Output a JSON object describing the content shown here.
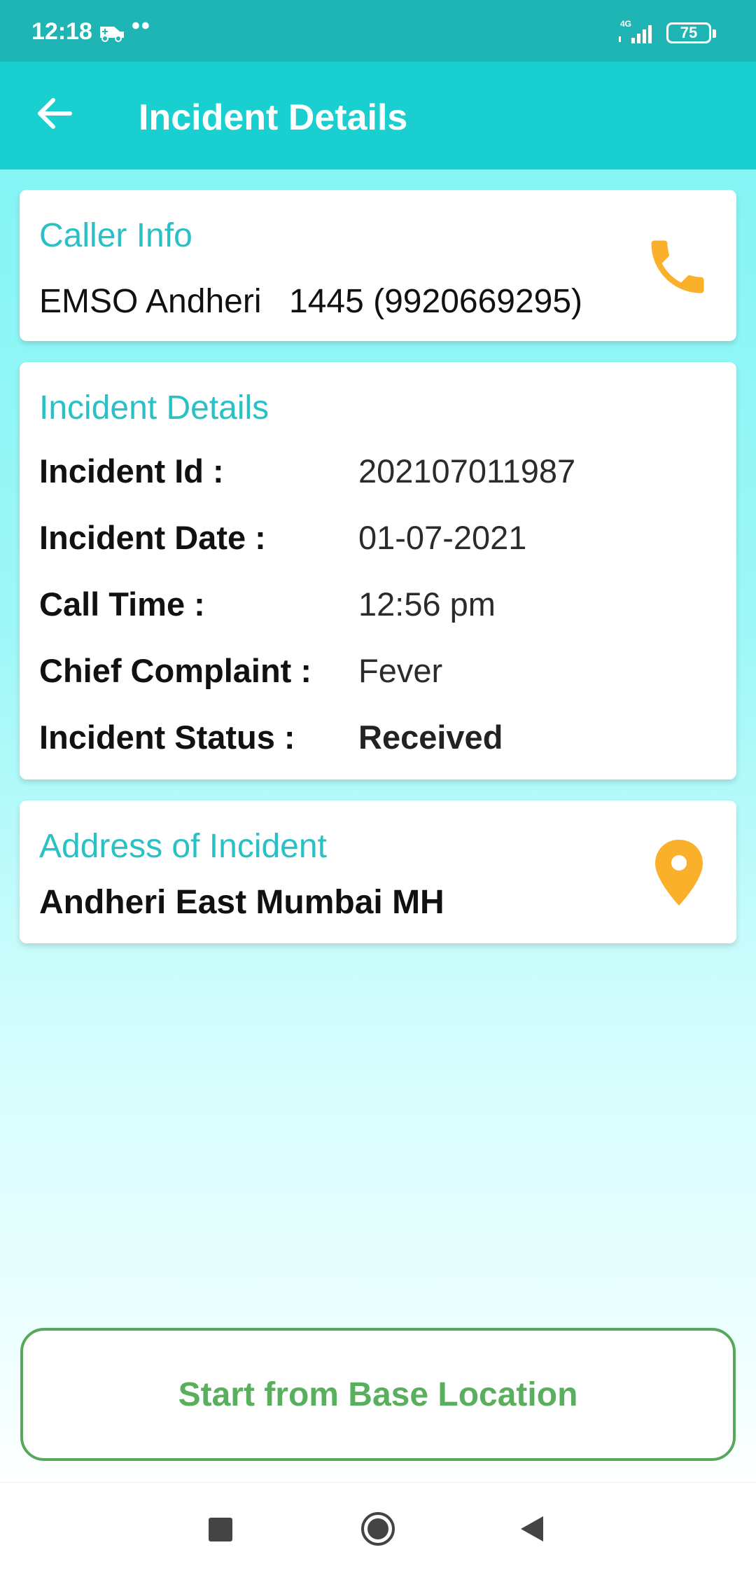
{
  "status_bar": {
    "time": "12:18",
    "dots": "••",
    "network": "4G",
    "battery": "75"
  },
  "app_bar": {
    "title": "Incident Details",
    "back_icon": "arrow-left-icon"
  },
  "caller_info": {
    "title": "Caller Info",
    "name": "EMSO Andheri",
    "number": "1445 (9920669295)",
    "action_icon": "phone-icon"
  },
  "incident_details": {
    "title": "Incident Details",
    "rows": [
      {
        "label": "Incident Id :",
        "value": "202107011987"
      },
      {
        "label": "Incident Date :",
        "value": "01-07-2021"
      },
      {
        "label": "Call Time :",
        "value": "12:56 pm"
      },
      {
        "label": "Chief Complaint :",
        "value": "Fever"
      },
      {
        "label": "Incident Status :",
        "value": "Received"
      }
    ]
  },
  "address": {
    "title": "Address of Incident",
    "text": "Andheri East Mumbai MH",
    "action_icon": "map-pin-icon"
  },
  "action": {
    "start_label": "Start from Base Location"
  },
  "nav_bar": {
    "icons": [
      "recents-square-icon",
      "home-circle-icon",
      "back-triangle-icon"
    ]
  },
  "colors": {
    "status_bar": "#1fb5b4",
    "app_bar": "#19cfcf",
    "accent_text": "#27c1c6",
    "icon_orange": "#fbb02b",
    "button_green": "#5aaf5e"
  }
}
